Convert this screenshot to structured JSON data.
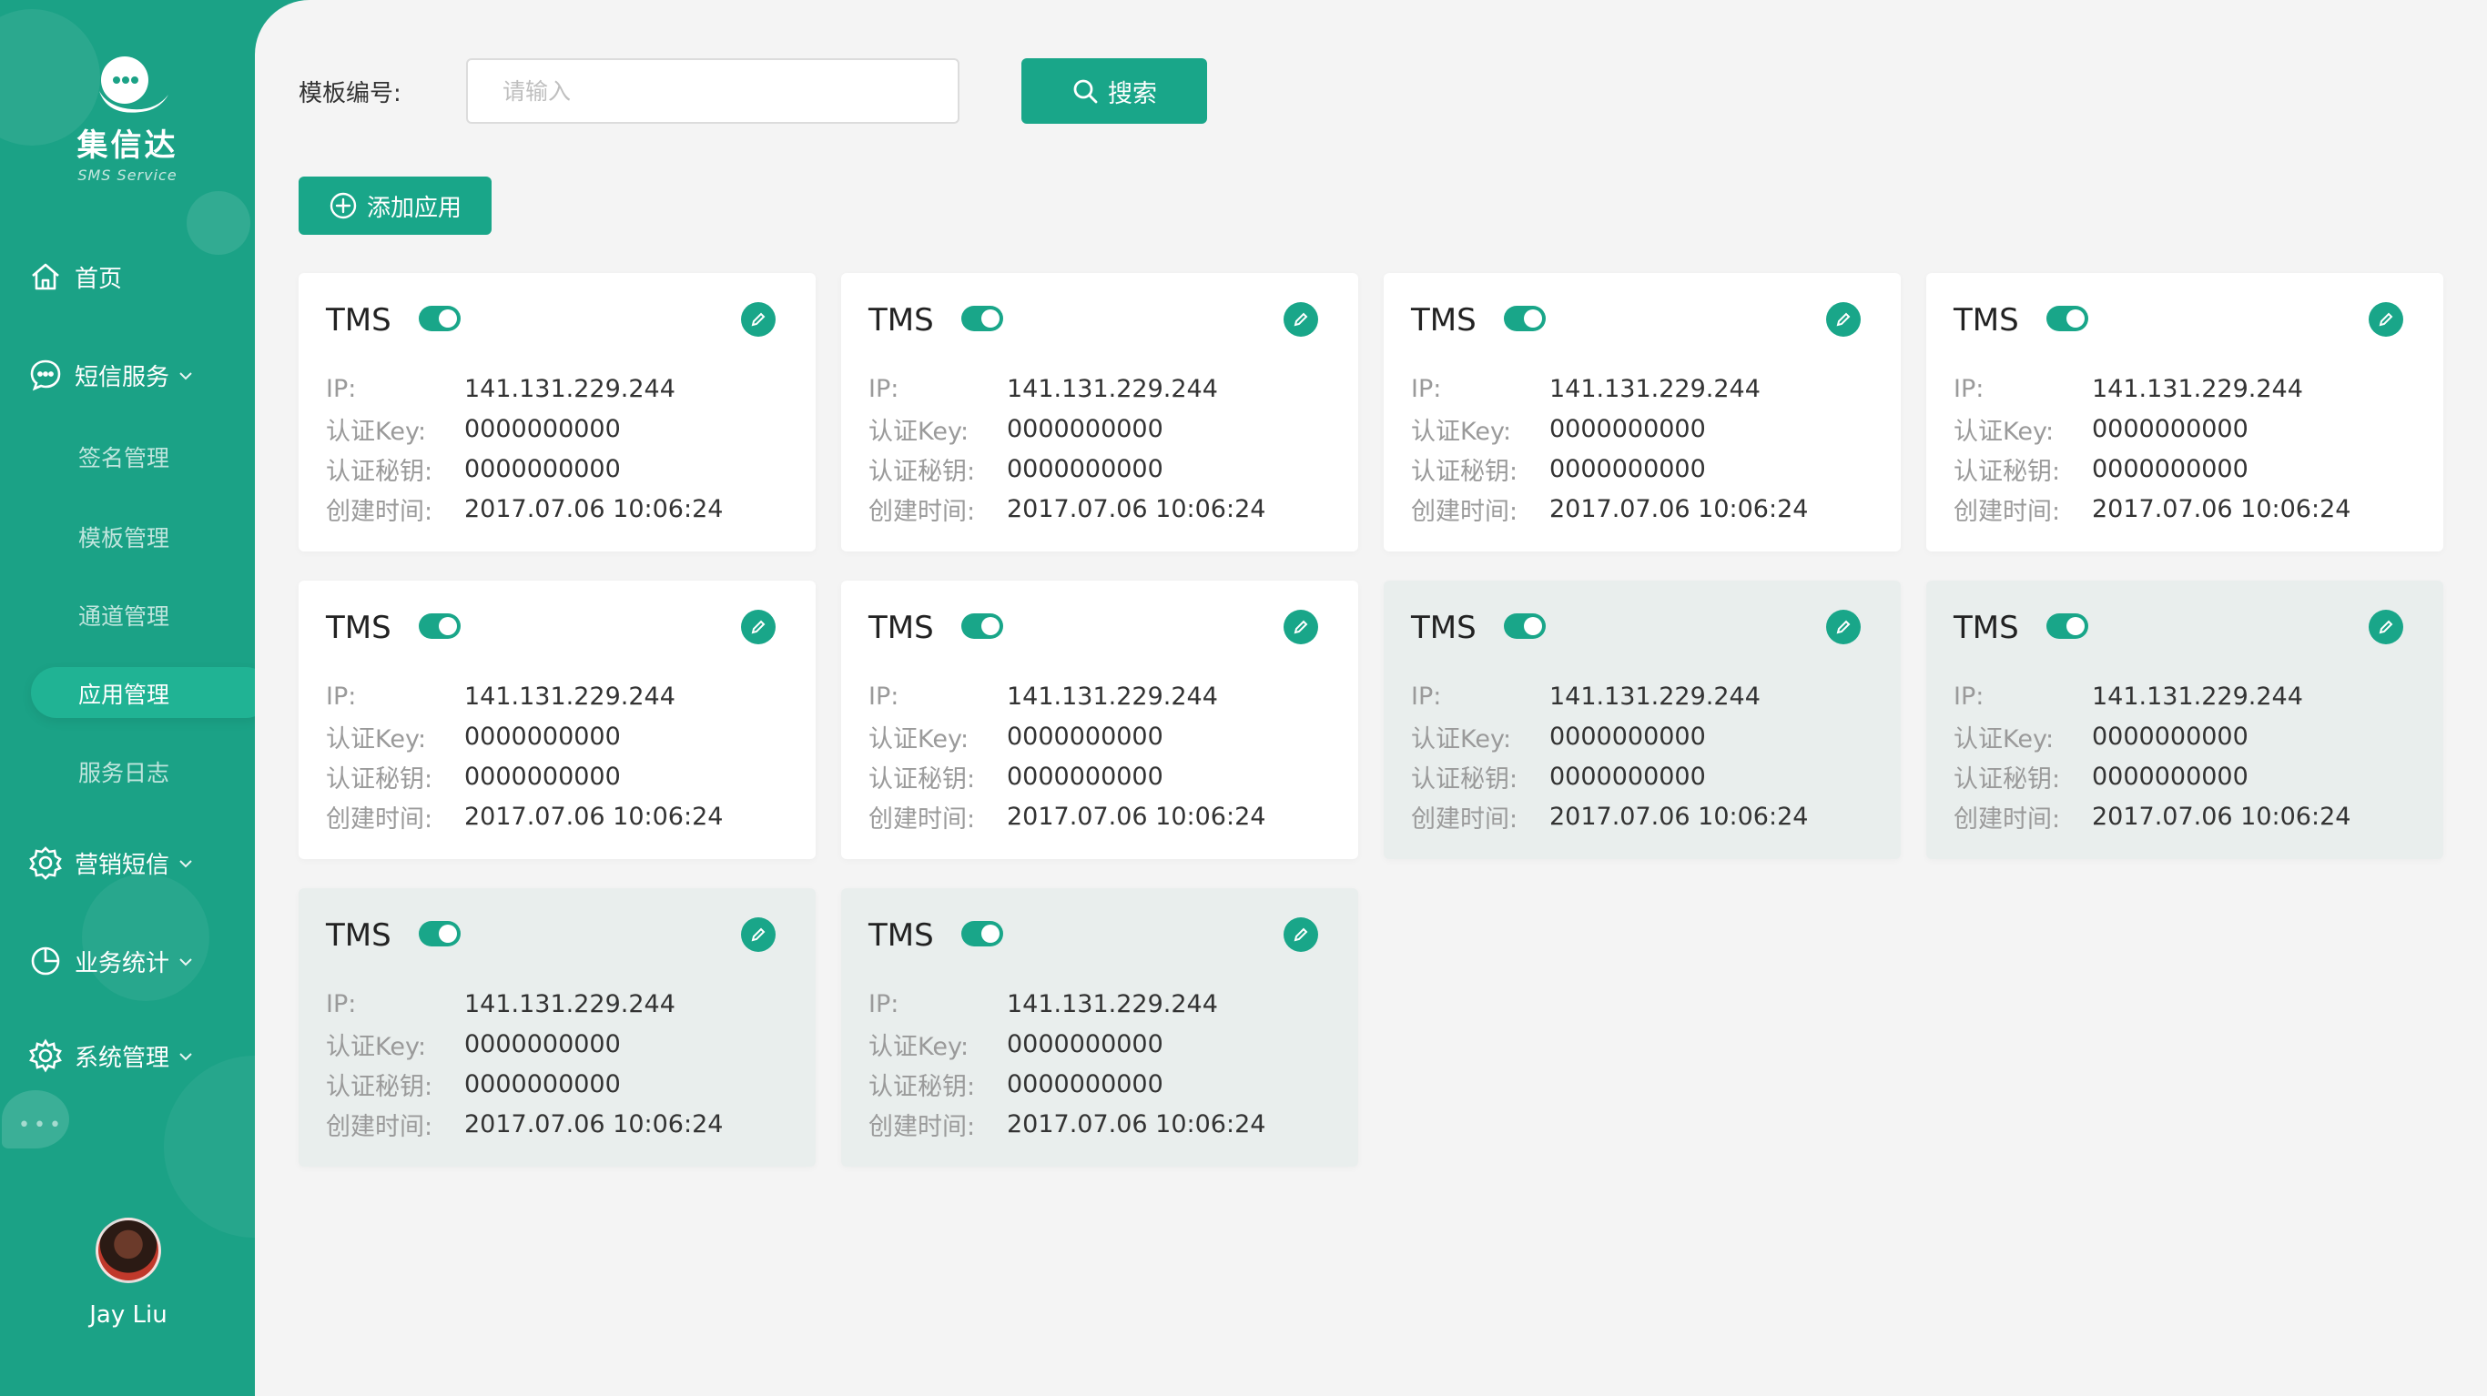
{
  "brand": {
    "name": "集信达",
    "subtitle": "SMS Service"
  },
  "sidebar": {
    "items": [
      {
        "label": "首页",
        "icon": "home-icon"
      },
      {
        "label": "短信服务",
        "icon": "chat-icon",
        "expandable": true
      },
      {
        "label": "营销短信",
        "icon": "marketing-icon",
        "expandable": true
      },
      {
        "label": "业务统计",
        "icon": "pie-chart-icon",
        "expandable": true
      },
      {
        "label": "系统管理",
        "icon": "gear-icon",
        "expandable": true
      }
    ],
    "sub_items": [
      {
        "label": "签名管理"
      },
      {
        "label": "模板管理"
      },
      {
        "label": "通道管理"
      },
      {
        "label": "应用管理",
        "active": true
      },
      {
        "label": "服务日志"
      }
    ]
  },
  "user": {
    "name": "Jay Liu"
  },
  "filter": {
    "label": "模板编号:",
    "placeholder": "请输入",
    "search_label": "搜索"
  },
  "add_button": {
    "label": "添加应用"
  },
  "field_labels": {
    "ip": "IP:",
    "key": "认证Key:",
    "secret": "认证秘钥:",
    "created": "创建时间:"
  },
  "apps": [
    {
      "name": "TMS",
      "enabled": true,
      "ip": "141.131.229.244",
      "key": "0000000000",
      "secret": "0000000000",
      "created": "2017.07.06 10:06:24"
    },
    {
      "name": "TMS",
      "enabled": true,
      "ip": "141.131.229.244",
      "key": "0000000000",
      "secret": "0000000000",
      "created": "2017.07.06 10:06:24"
    },
    {
      "name": "TMS",
      "enabled": true,
      "ip": "141.131.229.244",
      "key": "0000000000",
      "secret": "0000000000",
      "created": "2017.07.06 10:06:24"
    },
    {
      "name": "TMS",
      "enabled": true,
      "ip": "141.131.229.244",
      "key": "0000000000",
      "secret": "0000000000",
      "created": "2017.07.06 10:06:24"
    },
    {
      "name": "TMS",
      "enabled": true,
      "ip": "141.131.229.244",
      "key": "0000000000",
      "secret": "0000000000",
      "created": "2017.07.06 10:06:24"
    },
    {
      "name": "TMS",
      "enabled": true,
      "ip": "141.131.229.244",
      "key": "0000000000",
      "secret": "0000000000",
      "created": "2017.07.06 10:06:24"
    },
    {
      "name": "TMS",
      "enabled": true,
      "ip": "141.131.229.244",
      "key": "0000000000",
      "secret": "0000000000",
      "created": "2017.07.06 10:06:24"
    },
    {
      "name": "TMS",
      "enabled": true,
      "ip": "141.131.229.244",
      "key": "0000000000",
      "secret": "0000000000",
      "created": "2017.07.06 10:06:24"
    },
    {
      "name": "TMS",
      "enabled": true,
      "ip": "141.131.229.244",
      "key": "0000000000",
      "secret": "0000000000",
      "created": "2017.07.06 10:06:24"
    },
    {
      "name": "TMS",
      "enabled": true,
      "ip": "141.131.229.244",
      "key": "0000000000",
      "secret": "0000000000",
      "created": "2017.07.06 10:06:24"
    }
  ],
  "colors": {
    "accent": "#19a689",
    "sidebar": "#1ba286",
    "background": "#f4f4f4",
    "card_alt": "#e9eeed"
  }
}
